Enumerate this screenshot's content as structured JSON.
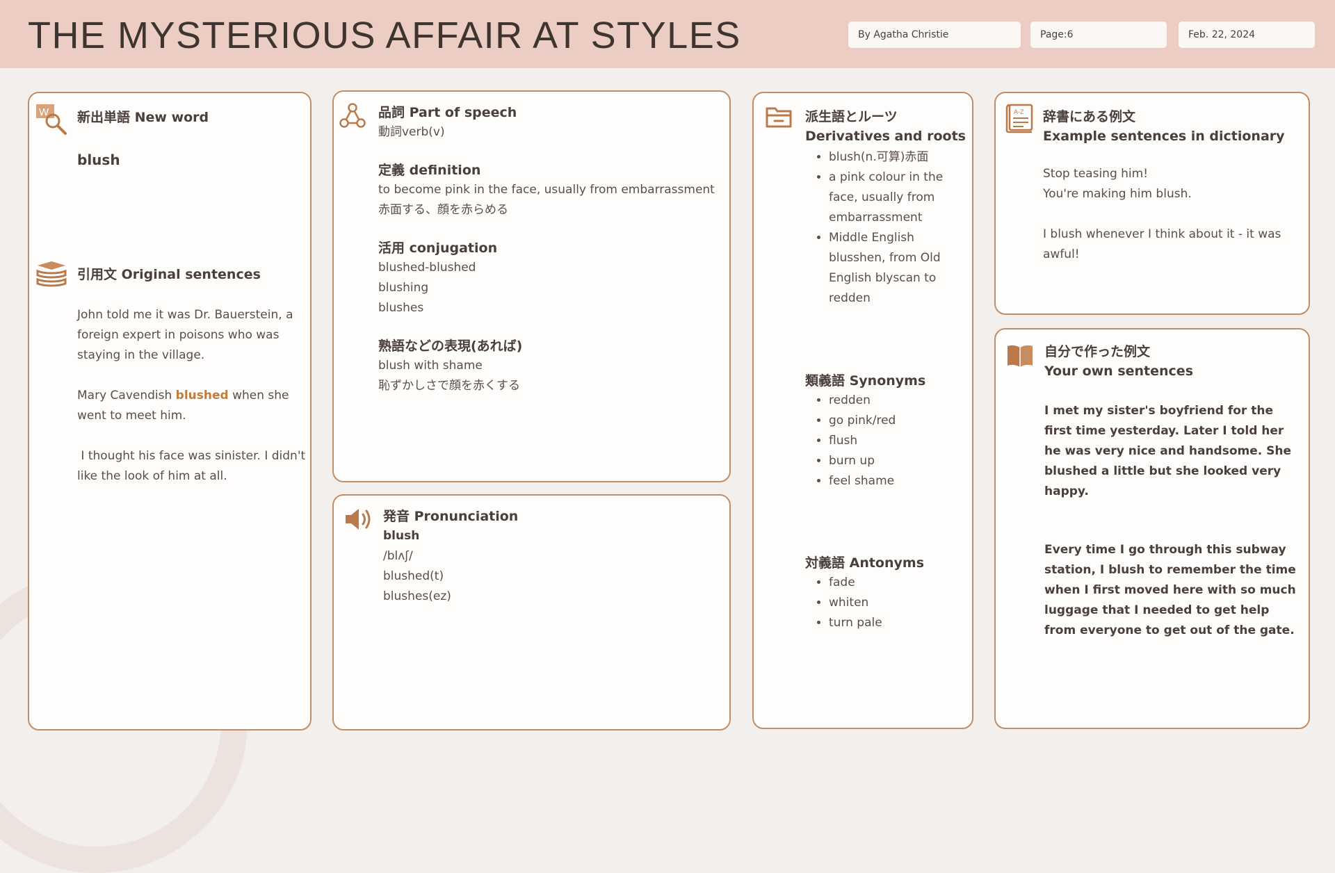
{
  "header": {
    "title": "THE MYSTERIOUS AFFAIR AT STYLES",
    "author": "By Agatha Christie",
    "page": "Page:6",
    "date": "Feb. 22, 2024"
  },
  "colors": {
    "accent": "#b9794a",
    "border": "#bf8e66",
    "header_bg": "#ebcdc3",
    "highlight": "#c07c3c"
  },
  "new_word": {
    "heading": "新出単語 New word",
    "word": "blush",
    "icon": "magnifier-w-icon"
  },
  "original": {
    "heading": "引用文 Original sentences",
    "icon": "books-icon",
    "p1": "John told me it was Dr. Bauerstein, a foreign expert in poisons who was staying in the village.",
    "p2_before": "Mary Cavendish ",
    "p2_highlight": "blushed",
    "p2_after": " when she went to meet him.",
    "p3": " I thought his face was sinister. I didn't like the look of him at all."
  },
  "speech": {
    "heading": "品詞 Part of speech",
    "icon": "nodes-icon",
    "pos": "動詞verb(v)",
    "definition_heading": "定義 definition",
    "definition_en": "to become pink in the face, usually from embarrassment",
    "definition_ja": "赤面する、顔を赤らめる",
    "conjugation_heading": "活用 conjugation",
    "conjugations": [
      "blushed-blushed",
      "blushing",
      "blushes"
    ],
    "idiom_heading": "熟語などの表現(あれば)",
    "idioms": [
      "blush with shame",
      "恥ずかしさで顔を赤くする"
    ]
  },
  "pronunciation": {
    "heading": "発音 Pronunciation",
    "icon": "speaker-icon",
    "word": "blush",
    "ipa": "/blʌʃ/",
    "forms": [
      "blushed(t)",
      "blushes(ez)"
    ]
  },
  "derivatives": {
    "heading_ja": "派生語とルーツ",
    "heading_en": "Derivatives and roots",
    "icon": "folder-icon",
    "items": [
      "blush(n.可算)赤面",
      "a pink colour in the face, usually from embarrassment",
      "Middle English blusshen, from Old English blyscan to redden"
    ],
    "synonyms_heading": "類義語 Synonyms",
    "synonyms": [
      "redden",
      "go pink/red",
      "flush",
      "burn up",
      "feel shame"
    ],
    "antonyms_heading": "対義語 Antonyms",
    "antonyms": [
      "fade",
      "whiten",
      "turn pale"
    ]
  },
  "dictionary": {
    "heading_ja": "辞書にある例文",
    "heading_en": "Example sentences in dictionary",
    "icon": "dictionary-az-icon",
    "lines": [
      "Stop teasing him!",
      "You're making him blush."
    ],
    "p2": "I blush whenever I think about it - it was awful!"
  },
  "own": {
    "heading_ja": "自分で作った例文",
    "heading_en": "Your own sentences",
    "icon": "open-book-icon",
    "p1": "I met my sister's boyfriend for the first time yesterday. Later I told her he was very nice and handsome. She blushed a little but she looked very happy.",
    "p2": "Every time I go through this subway station, I blush to remember the time when I first moved here with so much luggage that I needed to get help from everyone to get out of the gate."
  }
}
